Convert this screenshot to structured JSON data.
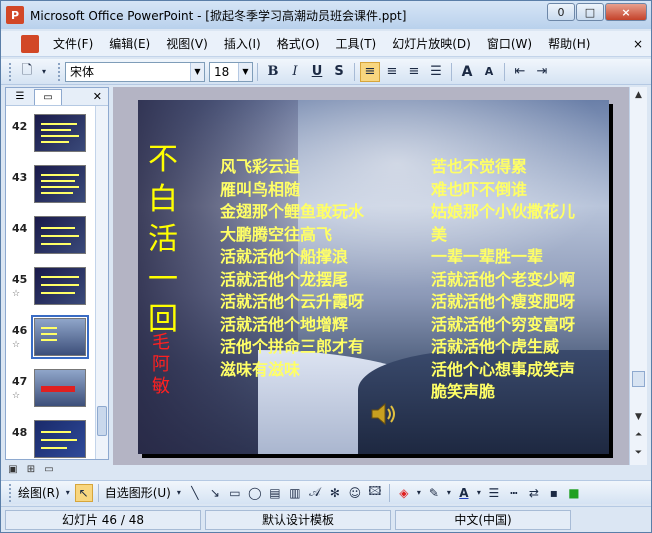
{
  "window": {
    "title": "Microsoft Office PowerPoint - [掀起冬季学习高潮动员班会课件.ppt]",
    "app_icon": "P",
    "minimize": "0",
    "restore": "□",
    "close": "×"
  },
  "menu": {
    "items": [
      "文件(F)",
      "编辑(E)",
      "视图(V)",
      "插入(I)",
      "格式(O)",
      "工具(T)",
      "幻灯片放映(D)",
      "窗口(W)",
      "帮助(H)"
    ],
    "close_doc": "×"
  },
  "toolbar": {
    "font": "宋体",
    "size": "18",
    "bold": "B",
    "italic": "I",
    "underline": "U",
    "shadow": "S",
    "grow_font": "A",
    "shrink_font": "A"
  },
  "slides_panel": {
    "thumbnails": [
      {
        "number": "42",
        "star": ""
      },
      {
        "number": "43",
        "star": ""
      },
      {
        "number": "44",
        "star": ""
      },
      {
        "number": "45",
        "star": "☆"
      },
      {
        "number": "46",
        "star": "☆"
      },
      {
        "number": "47",
        "star": "☆"
      },
      {
        "number": "48",
        "star": ""
      }
    ],
    "selected_number": "46"
  },
  "slide": {
    "title": "不白活一回",
    "author": "毛阿敏",
    "poem_left": [
      "风飞彩云追",
      "雁叫鸟相随",
      "金翅那个鲤鱼敢玩水",
      "大鹏腾空往高飞",
      "活就活他个船撑浪",
      "活就活他个龙摆尾",
      "活就活他个云升霞呀",
      "活就活他个地增辉",
      "活他个拼命三郎才有",
      "滋味有滋味"
    ],
    "poem_right": [
      "苦也不觉得累",
      "难也吓不倒谁",
      "姑娘那个小伙撒花儿",
      "美",
      "一辈一辈胜一辈",
      "活就活他个老变少啊",
      "活就活他个瘦变肥呀",
      "活就活他个穷变富呀",
      "活就活他个虎生威",
      "活他个心想事成笑声",
      "脆笑声脆"
    ]
  },
  "drawing_toolbar": {
    "draw": "绘图(R)",
    "autoshapes": "自选图形(U)"
  },
  "status": {
    "slide_info": "幻灯片 46 / 48",
    "design": "默认设计模板",
    "language": "中文(中国)"
  },
  "colors": {
    "title_yellow": "#ffff00",
    "poem_yellow": "#ffff66",
    "author_red": "#ff2020"
  }
}
